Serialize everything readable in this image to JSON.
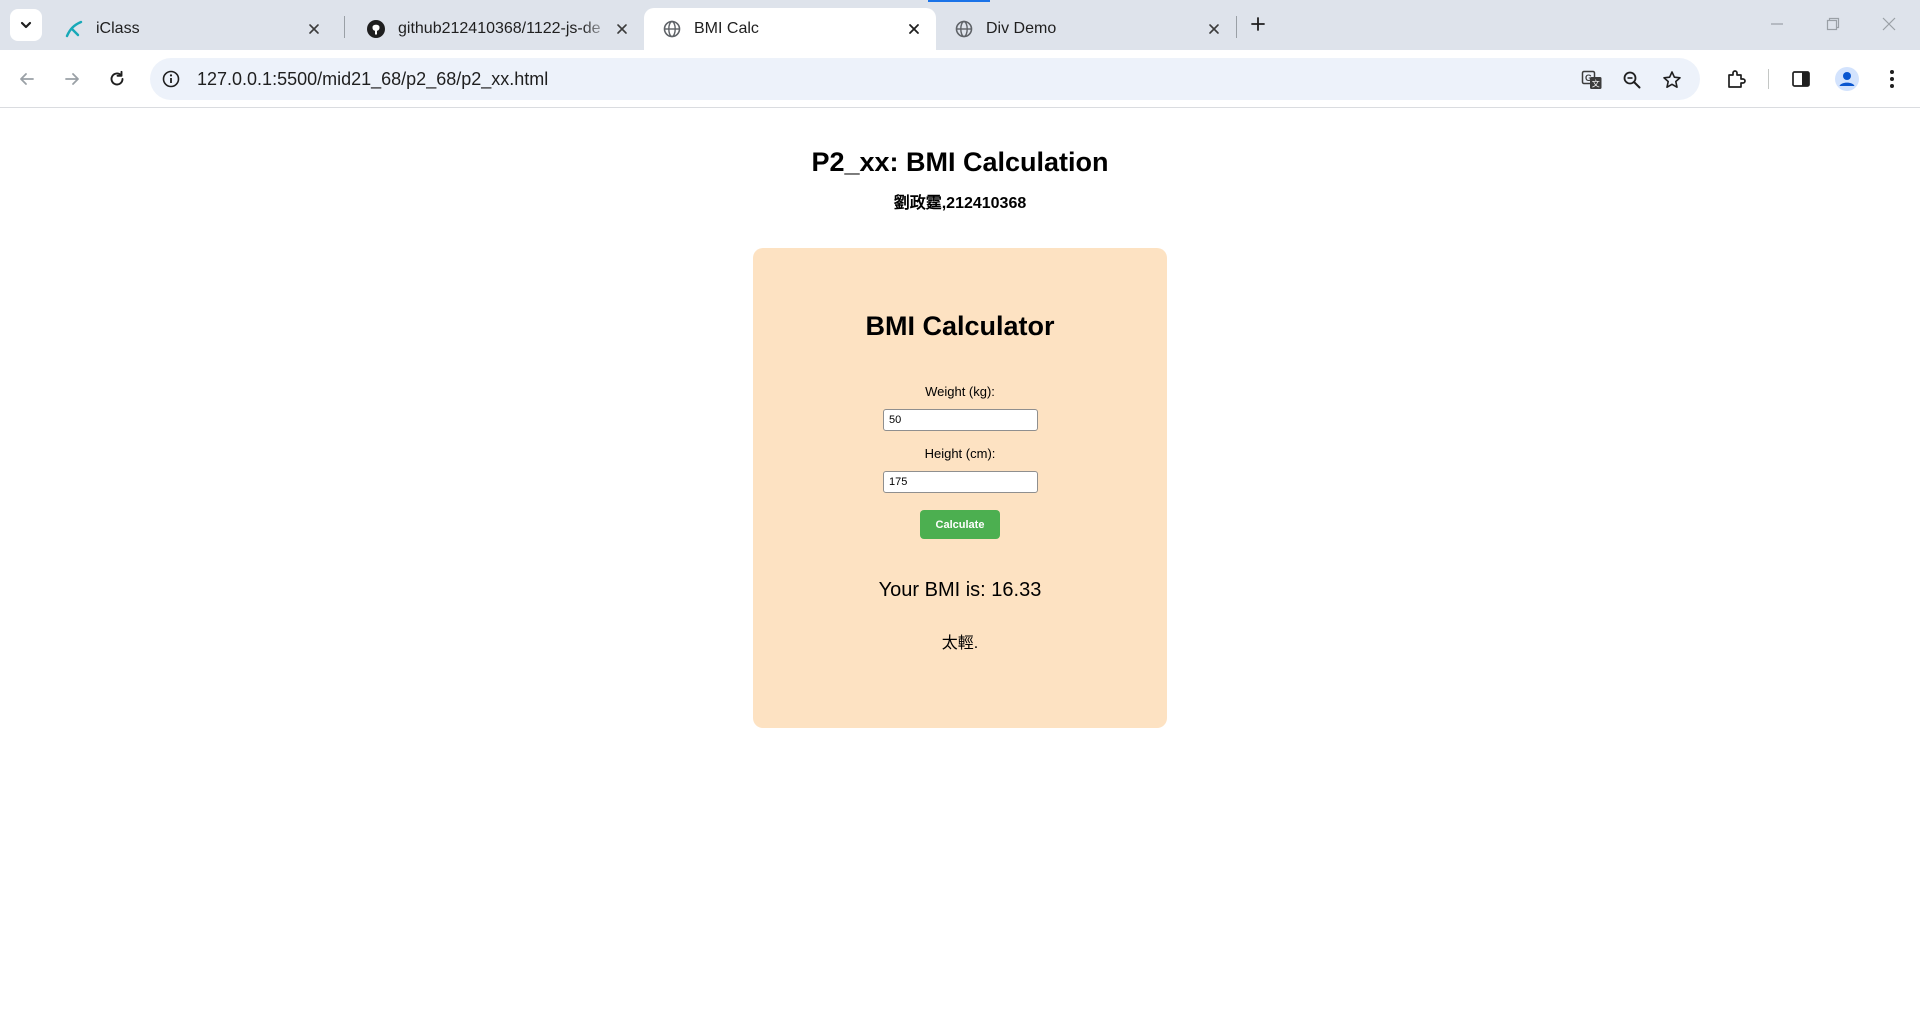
{
  "tabs": [
    {
      "title": "iClass",
      "favicon": "iclass-icon",
      "active": false
    },
    {
      "title": "github212410368/1122-js-de",
      "favicon": "github-icon",
      "active": false
    },
    {
      "title": "BMI Calc",
      "favicon": "globe-icon",
      "active": true
    },
    {
      "title": "Div Demo",
      "favicon": "globe-icon",
      "active": false
    }
  ],
  "toolbar": {
    "url": "127.0.0.1:5500/mid21_68/p2_68/p2_xx.html"
  },
  "page": {
    "title": "P2_xx: BMI Calculation",
    "subtitle": "劉政霆,212410368"
  },
  "calculator": {
    "title": "BMI Calculator",
    "weight_label": "Weight (kg):",
    "weight_value": "50",
    "height_label": "Height (cm):",
    "height_value": "175",
    "button_label": "Calculate",
    "result_text": "Your BMI is: 16.33",
    "verdict_text": "太輕."
  },
  "colors": {
    "tabstrip": "#dee3eb",
    "omnibox": "#edf2fa",
    "card_background": "#fde2c2",
    "button": "#4caf50",
    "loading_accent": "#1a73e8"
  }
}
